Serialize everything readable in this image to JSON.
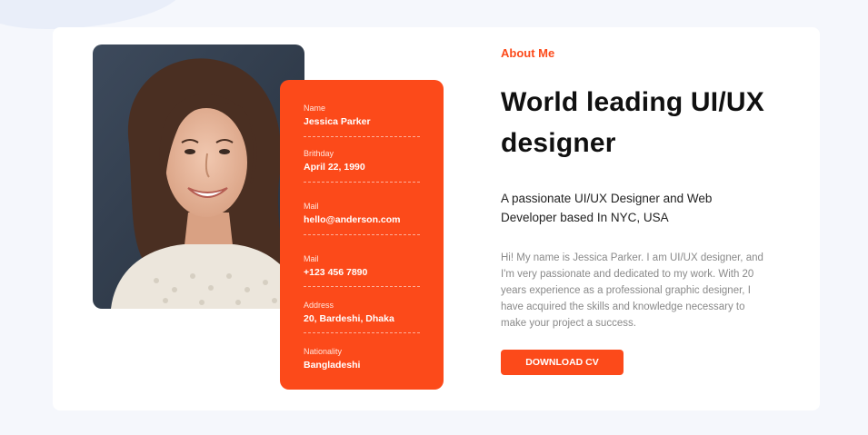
{
  "about": {
    "eyebrow": "About Me",
    "headline_line1": "World leading UI/UX",
    "headline_line2": "designer",
    "subhead_line1": "A passionate UI/UX Designer and Web",
    "subhead_line2": "Developer based In NYC, USA",
    "body_lines": [
      "Hi! My name is Jessica Parker. I am UI/UX designer, and",
      "I'm very passionate and dedicated to my work. With 20",
      "years experience as a professional graphic designer, I",
      "have acquired the skills and knowledge necessary to",
      "make your project a success."
    ],
    "cta_label": "DOWNLOAD CV"
  },
  "info": [
    {
      "label": "Name",
      "value": "Jessica Parker"
    },
    {
      "label": "Brithday",
      "value": "April 22, 1990"
    },
    {
      "label": "Mail",
      "value": "hello@anderson.com"
    },
    {
      "label": "Mail",
      "value": "+123 456 7890"
    },
    {
      "label": "Address",
      "value": "20, Bardeshi, Dhaka"
    },
    {
      "label": "Nationality",
      "value": "Bangladeshi"
    }
  ],
  "colors": {
    "accent": "#fc4a1a",
    "page_bg": "#f5f7fc",
    "card_bg": "#ffffff"
  }
}
